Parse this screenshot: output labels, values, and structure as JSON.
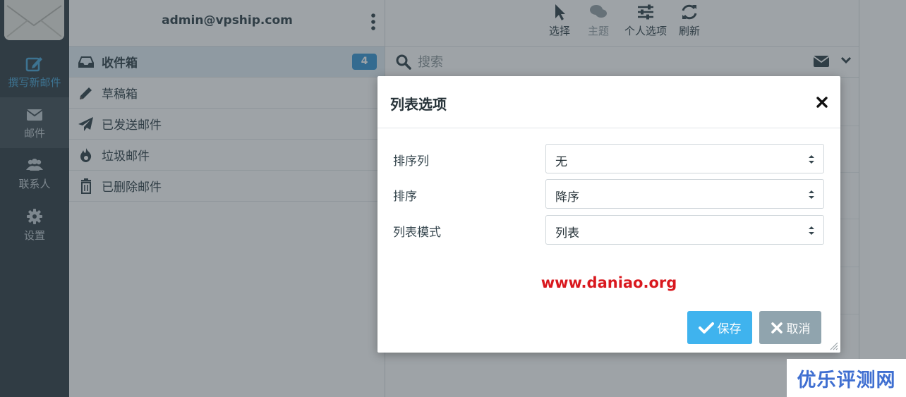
{
  "nav": {
    "items": [
      {
        "label": "撰写新邮件",
        "icon": "compose-icon"
      },
      {
        "label": "邮件",
        "icon": "mail-icon"
      },
      {
        "label": "联系人",
        "icon": "contacts-icon"
      },
      {
        "label": "设置",
        "icon": "settings-icon"
      }
    ]
  },
  "account": {
    "email": "admin@vpship.com"
  },
  "folders": [
    {
      "label": "收件箱",
      "icon": "inbox-icon",
      "badge": "4"
    },
    {
      "label": "草稿箱",
      "icon": "pencil-icon"
    },
    {
      "label": "已发送邮件",
      "icon": "paper-plane-icon"
    },
    {
      "label": "垃圾邮件",
      "icon": "fire-icon"
    },
    {
      "label": "已删除邮件",
      "icon": "trash-icon"
    }
  ],
  "toolbar": {
    "select": "选择",
    "thread": "主题",
    "options": "个人选项",
    "refresh": "刷新"
  },
  "search": {
    "placeholder": "搜索"
  },
  "modal": {
    "title": "列表选项",
    "fields": [
      {
        "label": "排序列",
        "value": "无"
      },
      {
        "label": "排序",
        "value": "降序"
      },
      {
        "label": "列表模式",
        "value": "列表"
      }
    ],
    "watermark": "www.daniao.org",
    "save": "保存",
    "cancel": "取消"
  },
  "corner_watermark": "优乐评测网",
  "colors": {
    "accent": "#3fb3ee",
    "badge": "#3e9ad6",
    "sidebar": "#37444c",
    "cancel": "#90a4ae",
    "watermark": "#d9181e"
  }
}
